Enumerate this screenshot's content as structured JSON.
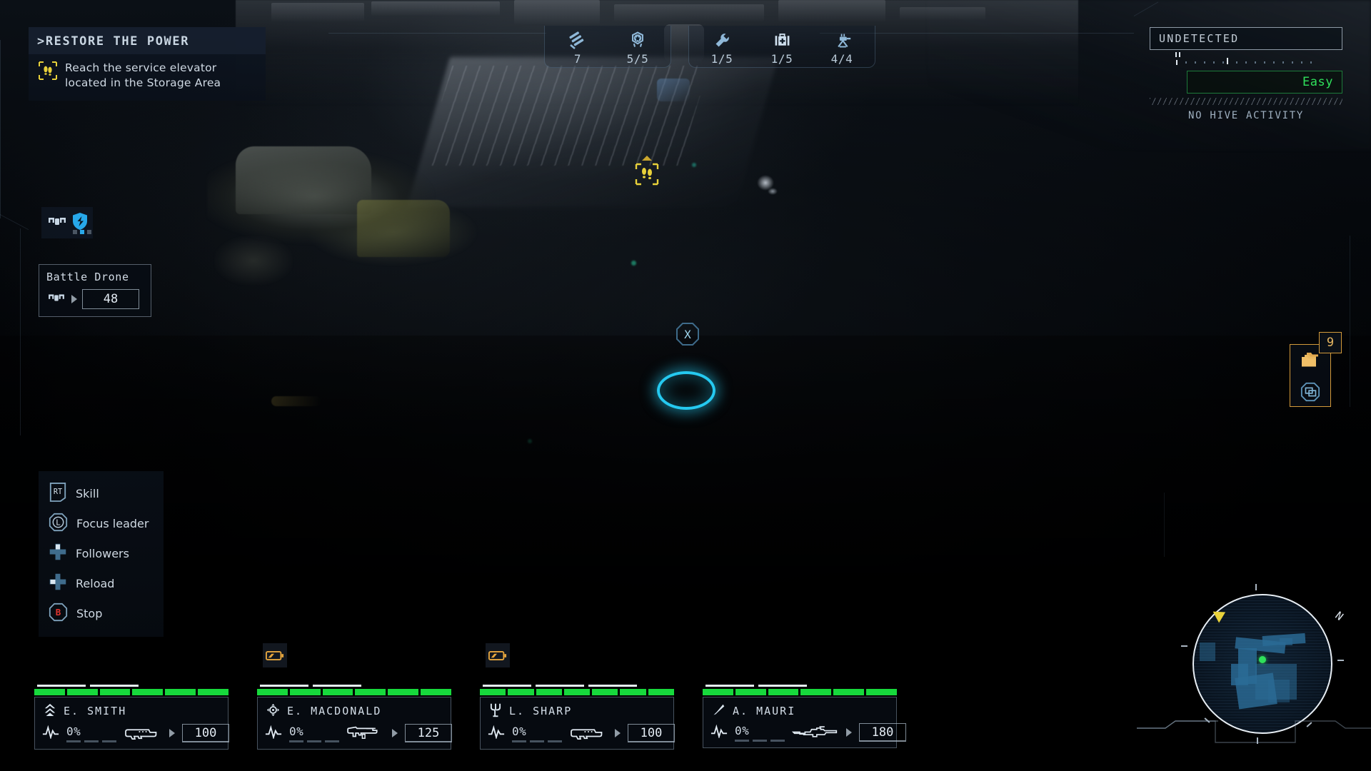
{
  "objective": {
    "title": ">RESTORE THE POWER",
    "icon": "footprints-icon",
    "task_line1": "Reach the service elevator",
    "task_line2": "located in the Storage Area"
  },
  "top_counters": {
    "groups": [
      {
        "items": [
          {
            "icon": "claw-slash-icon",
            "value": "7"
          },
          {
            "icon": "medal-star-icon",
            "value": "5/5"
          }
        ]
      },
      {
        "items": [
          {
            "icon": "wrench-icon",
            "value": "1/5"
          },
          {
            "icon": "medkit-icon",
            "value": "1/5"
          },
          {
            "icon": "turret-icon",
            "value": "4/4"
          }
        ]
      }
    ]
  },
  "status": {
    "detection": "UNDETECTED",
    "difficulty": "Easy",
    "hive_activity": "NO HIVE ACTIVITY",
    "difficulty_color": "#2fe05b"
  },
  "drone": {
    "badge_icon": "drone-icon",
    "shield_icon": "shield-icon",
    "charge_dots": [
      0,
      1,
      0
    ],
    "name": "Battle Drone",
    "stat_icon": "drone-icon",
    "value": "48"
  },
  "hints": [
    {
      "key": "RT",
      "key_style": "bumper",
      "label": "Skill",
      "icon": "rt-trigger-icon"
    },
    {
      "key": "L",
      "key_style": "octagon",
      "label": "Focus leader",
      "icon": "l-button-icon"
    },
    {
      "key": "",
      "key_style": "dpad-up",
      "label": "Followers",
      "icon": "dpad-up-icon"
    },
    {
      "key": "",
      "key_style": "dpad-left",
      "label": "Reload",
      "icon": "dpad-left-icon"
    },
    {
      "key": "B",
      "key_style": "octagon-red",
      "label": "Stop",
      "icon": "b-button-icon"
    }
  ],
  "inventory": {
    "count": "9",
    "folder_icon": "folder-stack-icon",
    "swap_icon": "swap-octagon-icon"
  },
  "world": {
    "objective_marker_icon": "footprints-marker-icon",
    "button_prompt": "X",
    "ground_ring_color": "#25c9f0"
  },
  "squad": [
    {
      "role_icon": "chevron-rank-icon",
      "name": "E. SMITH",
      "accuracy": "0%",
      "weapon_icon": "assault-rifle-icon",
      "ammo": "100",
      "hp_segments": 6,
      "pips": 2,
      "status_badge": null
    },
    {
      "role_icon": "crosshair-icon",
      "name": "E. MACDONALD",
      "accuracy": "0%",
      "weapon_icon": "smart-gun-icon",
      "ammo": "125",
      "hp_segments": 6,
      "pips": 2,
      "status_badge": "battery-low-icon"
    },
    {
      "role_icon": "trident-icon",
      "name": "L. SHARP",
      "accuracy": "0%",
      "weapon_icon": "assault-rifle-icon",
      "ammo": "100",
      "hp_segments": 7,
      "pips": 3,
      "status_badge": "battery-low-icon"
    },
    {
      "role_icon": "blade-icon",
      "name": "A. MAURI",
      "accuracy": "0%",
      "weapon_icon": "sniper-rifle-icon",
      "ammo": "180",
      "hp_segments": 6,
      "pips": 2,
      "status_badge": null
    }
  ],
  "minimap": {
    "compass_north": "N",
    "player_marker_color": "#2fe05b",
    "objective_marker_color": "#e8d13a",
    "terrain_color": "#2b6b96"
  }
}
